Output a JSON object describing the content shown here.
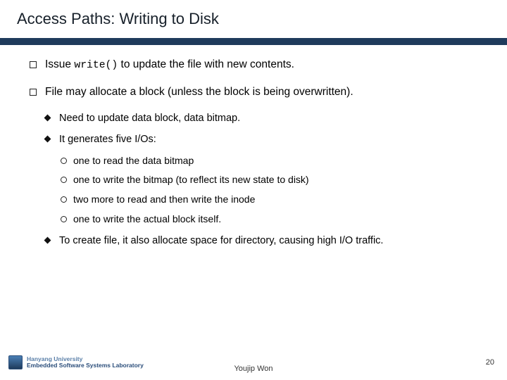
{
  "title": "Access Paths: Writing to Disk",
  "bullets": {
    "b1_pre": "Issue ",
    "b1_code": "write()",
    "b1_post": " to update the file with new contents.",
    "b2": "File may allocate a block (unless the block is being overwritten).",
    "b2_1": "Need to update data block, data bitmap.",
    "b2_2": "It generates five I/Os:",
    "b2_2_1": "one to read the data bitmap",
    "b2_2_2": "one to write the bitmap (to reflect its new state to disk)",
    "b2_2_3": "two more to read and then write the inode",
    "b2_2_4": "one to write the actual block itself.",
    "b2_3": "To create file, it also allocate space for directory, causing high I/O traffic."
  },
  "footer": {
    "lab_top": "Hanyang University",
    "lab_bot": "Embedded Software Systems Laboratory",
    "author": "Youjip Won",
    "page": "20"
  }
}
